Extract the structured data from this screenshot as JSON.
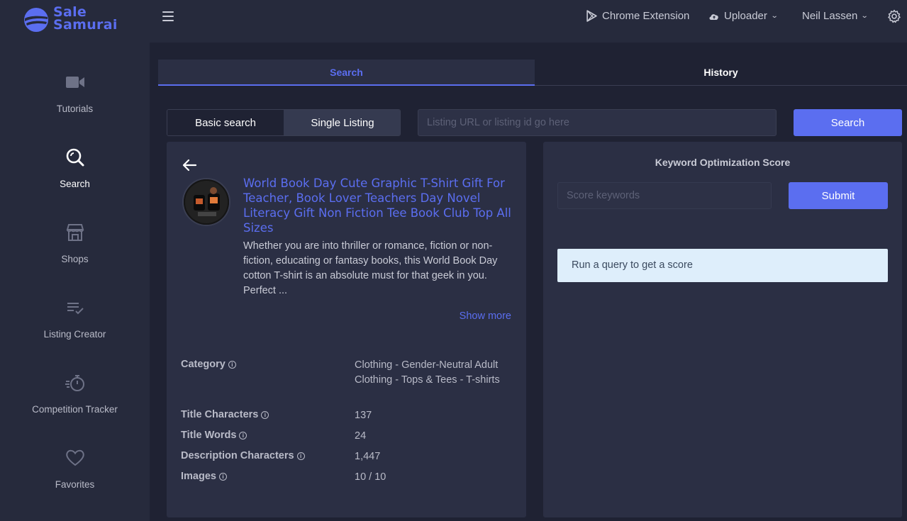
{
  "brand": {
    "logo_line1": "Sale",
    "logo_line2": "Samurai",
    "accent": "#5b6ef0"
  },
  "header": {
    "chrome_extension": "Chrome Extension",
    "uploader": "Uploader",
    "user": "Neil Lassen"
  },
  "sidebar": {
    "items": [
      {
        "label": "Tutorials",
        "icon": "video-camera-icon"
      },
      {
        "label": "Search",
        "icon": "search-icon",
        "active": true
      },
      {
        "label": "Shops",
        "icon": "shop-icon"
      },
      {
        "label": "Listing Creator",
        "icon": "list-check-icon"
      },
      {
        "label": "Competition Tracker",
        "icon": "stopwatch-icon"
      },
      {
        "label": "Favorites",
        "icon": "heart-icon"
      }
    ]
  },
  "tabs": {
    "search": "Search",
    "history": "History"
  },
  "search_row": {
    "basic": "Basic search",
    "single": "Single Listing",
    "url_placeholder": "Listing URL or listing id go here",
    "button": "Search"
  },
  "listing": {
    "title": "World Book Day Cute Graphic T-Shirt Gift For Teacher, Book Lover Teachers Day Novel Literacy Gift Non Fiction Tee Book Club Top All Sizes",
    "description": "Whether you are into thriller or romance, fiction or non-fiction, educating or fantasy books, this World Book Day cotton T-shirt is an absolute must for that geek in you. Perfect ...",
    "show_more": "Show more",
    "stats": [
      {
        "label": "Category",
        "value": "Clothing - Gender-Neutral Adult Clothing - Tops & Tees - T-shirts"
      },
      {
        "label": "Title Characters",
        "value": "137"
      },
      {
        "label": "Title Words",
        "value": "24"
      },
      {
        "label": "Description Characters",
        "value": "1,447"
      },
      {
        "label": "Images",
        "value": "10 / 10"
      }
    ]
  },
  "keyword": {
    "title": "Keyword Optimization Score",
    "placeholder": "Score keywords",
    "submit": "Submit",
    "message": "Run a query to get a score"
  }
}
